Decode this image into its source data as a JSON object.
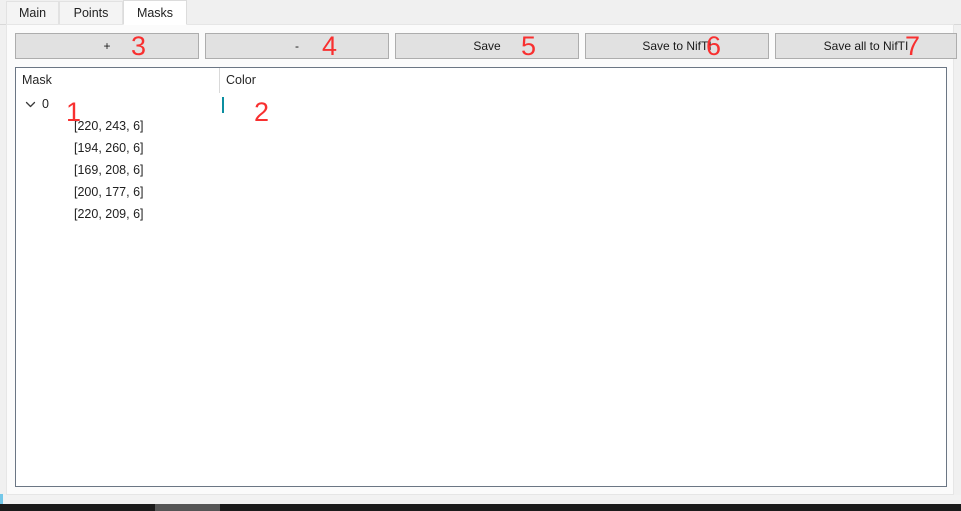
{
  "tabs": [
    {
      "label": "Main",
      "active": false
    },
    {
      "label": "Points",
      "active": false
    },
    {
      "label": "Masks",
      "active": true
    }
  ],
  "toolbar": {
    "add_label": "+",
    "remove_label": "-",
    "save_label": "Save",
    "save_nifti_label": "Save to NifTI",
    "save_all_nifti_label": "Save all to NifTI"
  },
  "tree": {
    "columns": {
      "mask": "Mask",
      "color": "Color"
    },
    "root": {
      "chevron": "chevron-down-icon",
      "label": "0",
      "color_hex": "#20EEFC"
    },
    "points": [
      "[220, 243, 6]",
      "[194, 260, 6]",
      "[169, 208, 6]",
      "[200, 177, 6]",
      "[220, 209, 6]"
    ]
  },
  "annotations": {
    "a1": "1",
    "a2": "2",
    "a3": "3",
    "a4": "4",
    "a5": "5",
    "a6": "6",
    "a7": "7",
    "color_hex": "#F83030"
  }
}
